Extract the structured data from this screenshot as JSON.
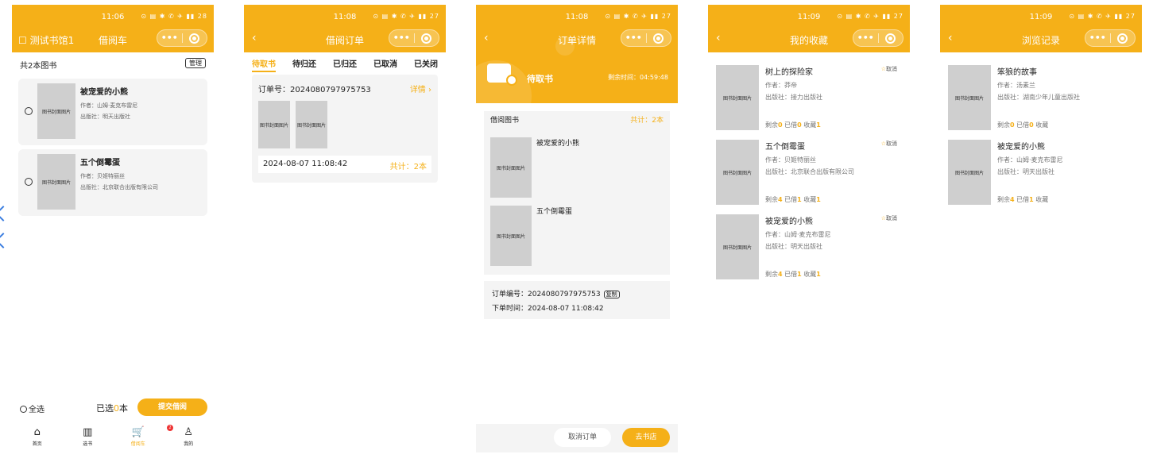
{
  "accent": "#F5B018",
  "screen1": {
    "time": "11:06",
    "status_icons": "⊙ ▤ ✱ ✆ ✈ ▮▮ 28",
    "library": "☐ 测试书馆1",
    "title": "借阅车",
    "count": "共2本图书",
    "manage": "管理",
    "cover_label": "图书封面图片",
    "books": [
      {
        "title": "被宠爱的小熊",
        "author": "作者：山姆·麦克布雷尼",
        "publisher": "出版社：明天出版社"
      },
      {
        "title": "五个倒霉蛋",
        "author": "作者：贝姬特丽丝",
        "publisher": "出版社：北京联合出版有限公司"
      }
    ],
    "select_all": "全选",
    "selected_prefix": "已选",
    "selected_num": "0",
    "selected_suffix": "本",
    "submit": "提交借阅",
    "tabs": [
      {
        "icon": "⌂",
        "label": "首页"
      },
      {
        "icon": "▥",
        "label": "选书"
      },
      {
        "icon": "🛒",
        "label": "借阅车",
        "badge": "2"
      },
      {
        "icon": "♙",
        "label": "我的"
      }
    ]
  },
  "screen2": {
    "time": "11:08",
    "status_icons": "⊙ ▤ ✱ ✆ ✈ ▮▮ 27",
    "title": "借阅订单",
    "tabs": [
      "待取书",
      "待归还",
      "已归还",
      "已取消",
      "已关闭"
    ],
    "order_no": "订单号：2024080797975753",
    "detail": "详情 ›",
    "cover_label": "图书封面图片",
    "date": "2024-08-07 11:08:42",
    "total": "共计：2本"
  },
  "screen3": {
    "time": "11:08",
    "status_icons": "⊙ ▤ ✱ ✆ ✈ ▮▮ 27",
    "title": "订单详情",
    "status": "待取书",
    "remain": "剩余时间：04:59:48",
    "books_header": "借阅图书",
    "books_total": "共计：2本",
    "cover_label": "图书封面图片",
    "books": [
      "被宠爱的小熊",
      "五个倒霉蛋"
    ],
    "order_no": "订单编号：2024080797975753",
    "copy": "复制",
    "order_time": "下单时间：2024-08-07 11:08:42",
    "cancel": "取消订单",
    "go_store": "去书店"
  },
  "screen4": {
    "time": "11:09",
    "status_icons": "⊙ ▤ ✱ ✆ ✈ ▮▮ 27",
    "title": "我的收藏",
    "cover_label": "图书封面图片",
    "cancel_label": "取消",
    "stats_labels": {
      "remain": "剩余",
      "borrowed": "已借",
      "fav": "收藏"
    },
    "books": [
      {
        "title": "树上的探险家",
        "author": "作者：莽帝",
        "publisher": "出版社：接力出版社",
        "remain": "0",
        "borrowed": "0",
        "fav": "1"
      },
      {
        "title": "五个倒霉蛋",
        "author": "作者：贝姬特丽丝",
        "publisher": "出版社：北京联合出版有限公司",
        "remain": "4",
        "borrowed": "1",
        "fav": "1"
      },
      {
        "title": "被宠爱的小熊",
        "author": "作者：山姆·麦克布雷尼",
        "publisher": "出版社：明天出版社",
        "remain": "4",
        "borrowed": "1",
        "fav": "1"
      }
    ]
  },
  "screen5": {
    "time": "11:09",
    "status_icons": "⊙ ▤ ✱ ✆ ✈ ▮▮ 27",
    "title": "浏览记录",
    "cover_label": "图书封面图片",
    "stats_labels": {
      "remain": "剩余",
      "borrowed": "已借",
      "fav": "收藏"
    },
    "books": [
      {
        "title": "笨狼的故事",
        "author": "作者：汤素兰",
        "publisher": "出版社：湖南少年儿童出版社",
        "remain": "0",
        "borrowed": "0",
        "fav": ""
      },
      {
        "title": "被宠爱的小熊",
        "author": "作者：山姆·麦克布雷尼",
        "publisher": "出版社：明天出版社",
        "remain": "4",
        "borrowed": "1",
        "fav": ""
      }
    ]
  }
}
